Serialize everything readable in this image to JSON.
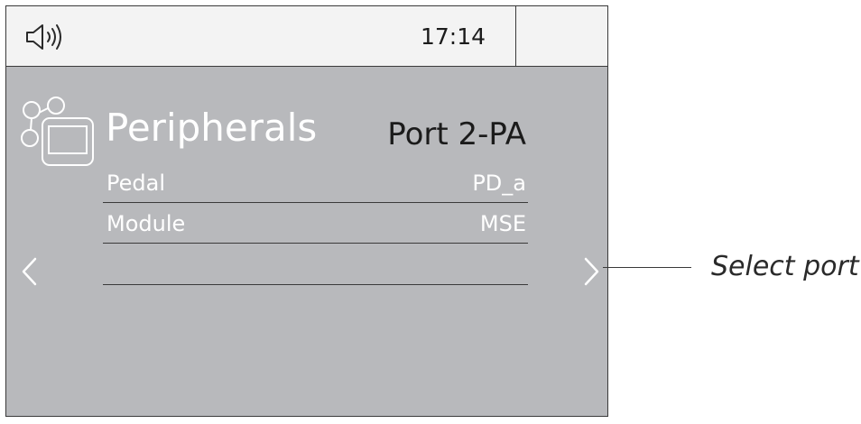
{
  "status_bar": {
    "icon": "speaker-icon",
    "time": "17:14"
  },
  "screen": {
    "icon": "peripherals-icon",
    "title": "Peripherals",
    "port": "Port 2-PA",
    "rows": [
      {
        "label": "Pedal",
        "value": "PD_a"
      },
      {
        "label": "Module",
        "value": "MSE"
      },
      {
        "label": "",
        "value": ""
      }
    ],
    "nav_left_icon": "chevron-left-icon",
    "nav_right_icon": "chevron-right-icon"
  },
  "callout": {
    "text": "Select port"
  },
  "colors": {
    "screen_background": "#b8b9bc",
    "status_background": "#f3f3f3",
    "text_light": "#ffffff",
    "text_dark": "#1b1b1b"
  }
}
